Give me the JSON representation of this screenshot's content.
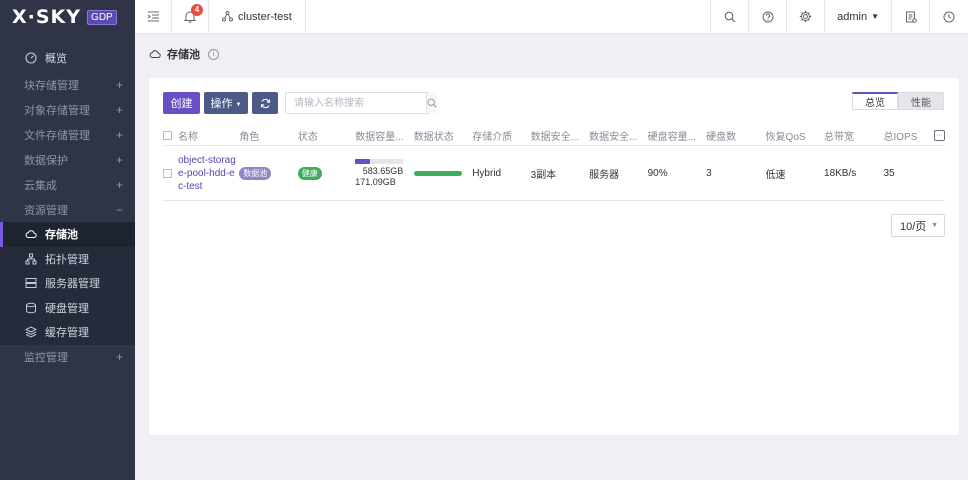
{
  "brand": {
    "logo_text": "X·SKY",
    "edition": "GDP"
  },
  "topbar": {
    "notification_count": "4",
    "cluster": "cluster-test",
    "user": "admin"
  },
  "sidebar": {
    "overview": "概览",
    "groups": [
      {
        "label": "块存储管理",
        "expander": "+"
      },
      {
        "label": "对象存储管理",
        "expander": "+"
      },
      {
        "label": "文件存储管理",
        "expander": "+"
      },
      {
        "label": "数据保护",
        "expander": "+"
      },
      {
        "label": "云集成",
        "expander": "+"
      },
      {
        "label": "资源管理",
        "expander": "−"
      }
    ],
    "resource_items": [
      {
        "label": "存储池",
        "icon": "cloud-icon"
      },
      {
        "label": "拓扑管理",
        "icon": "topology-icon"
      },
      {
        "label": "服务器管理",
        "icon": "server-icon"
      },
      {
        "label": "硬盘管理",
        "icon": "disk-icon"
      },
      {
        "label": "缓存管理",
        "icon": "cache-layers-icon"
      }
    ],
    "monitor": {
      "label": "监控管理",
      "expander": "+"
    }
  },
  "page": {
    "title": "存储池",
    "info": "i"
  },
  "toolbar": {
    "create": "创建",
    "operations": "操作",
    "search_placeholder": "请输入名称搜索"
  },
  "tabs": {
    "overview": "总览",
    "performance": "性能"
  },
  "table": {
    "headers": {
      "name": "名称",
      "role": "角色",
      "status": "状态",
      "data_capacity": "数据容量...",
      "data_status": "数据状态",
      "storage_media": "存储介质",
      "data_security_1": "数据安全...",
      "data_security_2": "数据安全...",
      "disk_capacity": "硬盘容量...",
      "disk_count": "硬盘数",
      "recovery_qos": "恢复QoS",
      "bandwidth": "总带宽",
      "iops": "总IOPS"
    },
    "rows": [
      {
        "name": "object-storage-pool-hdd-ec-test",
        "role": "数据池",
        "status": "健康",
        "capacity_used": "583.65GB",
        "capacity_total": "171.09GB",
        "capacity_fraction": 0.3,
        "data_status_fraction": 1.0,
        "media": "Hybrid",
        "security_1": "3副本",
        "security_2": "服务器",
        "disk_capacity": "90%",
        "disk_count": "3",
        "qos": "低速",
        "bandwidth": "18KB/s",
        "iops": "35"
      }
    ]
  },
  "pager": {
    "page_size": "10/页"
  },
  "colors": {
    "accent": "#6a4fc4",
    "sidebar_bg": "#2f3546",
    "health": "#3cae5a"
  }
}
